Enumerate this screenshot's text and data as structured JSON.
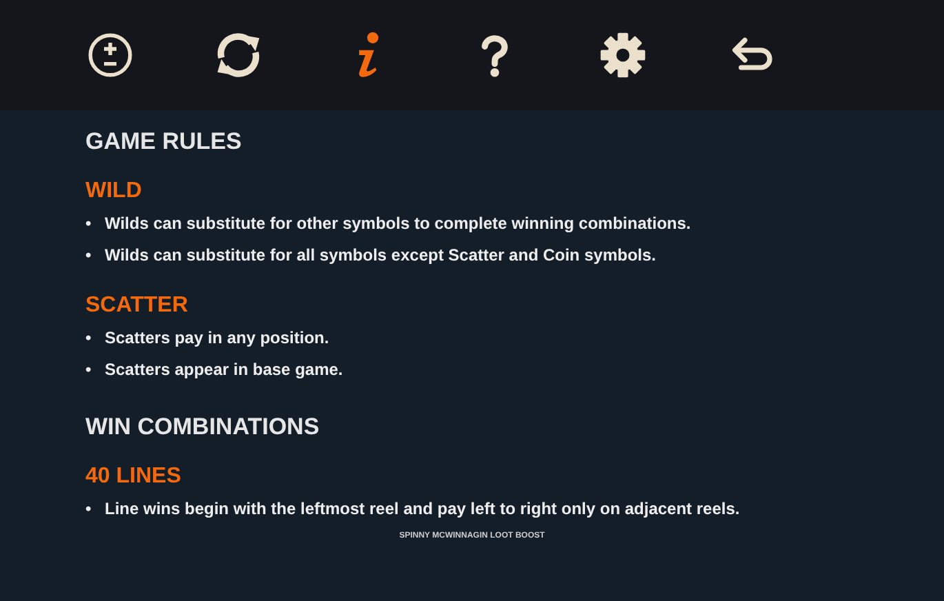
{
  "toolbar": [
    {
      "kind": "bet",
      "selected": false
    },
    {
      "kind": "autoplay",
      "selected": false
    },
    {
      "kind": "info",
      "selected": true
    },
    {
      "kind": "help",
      "selected": false
    },
    {
      "kind": "settings",
      "selected": false
    },
    {
      "kind": "back",
      "selected": false
    }
  ],
  "sections": [
    {
      "title": "GAME RULES",
      "groups": [
        {
          "heading": "WILD",
          "bullets": [
            {
              "marker": "•",
              "text": "Wilds can substitute for other symbols to complete winning combinations."
            },
            {
              "marker": "•",
              "text": "Wilds can substitute for all symbols except Scatter and Coin symbols."
            }
          ]
        },
        {
          "heading": "SCATTER",
          "bullets": [
            {
              "marker": "•",
              "text": "Scatters pay in any position."
            },
            {
              "marker": "•",
              "text": "Scatters appear in base game."
            }
          ]
        }
      ]
    },
    {
      "title": "WIN COMBINATIONS",
      "groups": [
        {
          "heading": "40 LINES",
          "bullets": [
            {
              "marker": "•",
              "text": "Line wins begin with the leftmost reel and pay left to right only on adjacent reels."
            }
          ]
        }
      ]
    }
  ],
  "footer": "SPINNY MCWINNAGIN LOOT BOOST"
}
